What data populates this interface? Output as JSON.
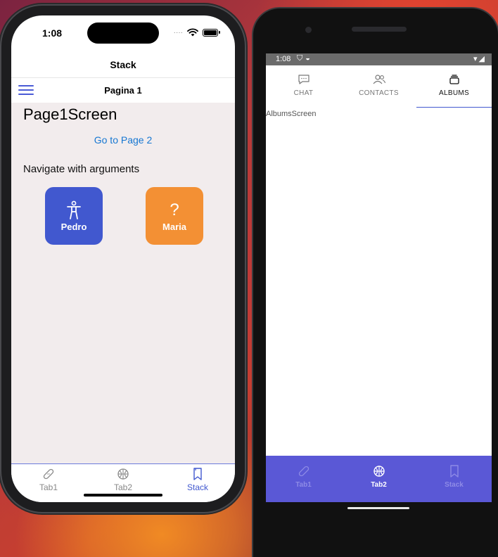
{
  "ios": {
    "status": {
      "time": "1:08"
    },
    "stack_title": "Stack",
    "nav_header_title": "Pagina 1",
    "page_title": "Page1Screen",
    "go_page2_link": "Go to Page 2",
    "nav_args_label": "Navigate with arguments",
    "people": [
      {
        "name": "Pedro",
        "icon": "accessibility-person-icon",
        "color": "#4158cf"
      },
      {
        "name": "Maria",
        "icon": "question-mark-icon",
        "color": "#f39034"
      }
    ],
    "tabs": [
      {
        "label": "Tab1",
        "icon": "bandage-icon",
        "active": false
      },
      {
        "label": "Tab2",
        "icon": "basketball-icon",
        "active": false
      },
      {
        "label": "Stack",
        "icon": "bookmarks-icon",
        "active": true
      }
    ]
  },
  "android": {
    "status": {
      "time": "1:08"
    },
    "top_tabs": [
      {
        "label": "CHAT",
        "icon": "chat-icon",
        "active": false
      },
      {
        "label": "CONTACTS",
        "icon": "contacts-icon",
        "active": false
      },
      {
        "label": "ALBUMS",
        "icon": "albums-icon",
        "active": true
      }
    ],
    "screen_text": "AlbumsScreen",
    "bottom_tabs": [
      {
        "label": "Tab1",
        "icon": "bandage-icon",
        "active": false
      },
      {
        "label": "Tab2",
        "icon": "basketball-icon",
        "active": true
      },
      {
        "label": "Stack",
        "icon": "bookmarks-icon",
        "active": false
      }
    ]
  },
  "colors": {
    "primary": "#4158cf",
    "accent_orange": "#f39034",
    "android_nav": "#5a58d6"
  }
}
